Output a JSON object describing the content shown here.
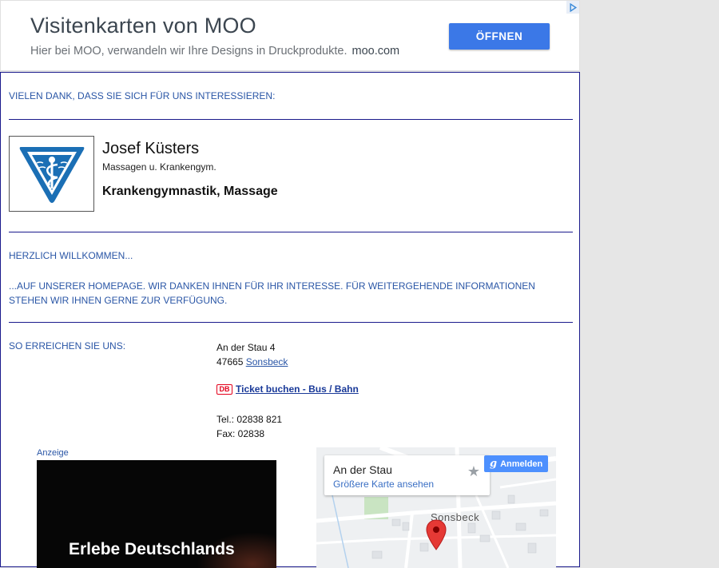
{
  "ad_top": {
    "title": "Visitenkarten von MOO",
    "description": "Hier bei MOO, verwandeln wir Ihre Designs in Druckprodukte.",
    "domain": "moo.com",
    "button_label": "ÖFFNEN",
    "button_color": "#3b78e7"
  },
  "intro": {
    "thanks": "VIELEN DANK, DASS SIE SICH FÜR UNS INTERESSIEREN:"
  },
  "business": {
    "name": "Josef Küsters",
    "subtitle": "Massagen u. Krankengym.",
    "category": "Krankengymnastik, Massage"
  },
  "welcome": {
    "heading": "HERZLICH WILLKOMMEN...",
    "text": "...AUF UNSERER HOMEPAGE. WIR DANKEN IHNEN FÜR IHR INTERESSE. FÜR WEITERGEHENDE INFORMATIONEN STEHEN WIR IHNEN GERNE ZUR VERFÜGUNG."
  },
  "contact": {
    "label": "SO ERREICHEN SIE UNS:",
    "street": "An der Stau 4",
    "zip": "47665",
    "city": "Sonsbeck",
    "db_logo": "DB",
    "ticket_link": "Ticket buchen - Bus / Bahn",
    "tel": "Tel.: 02838 821",
    "fax": "Fax: 02838"
  },
  "video_ad": {
    "label": "Anzeige",
    "text": "Erlebe Deutschlands"
  },
  "map": {
    "place_title": "An der Stau",
    "larger_map_link": "Größere Karte ansehen",
    "signin_label": "Anmelden",
    "signin_g": "g",
    "town_label": "Sonsbeck",
    "pin_color": "#e53935"
  },
  "colors": {
    "text_blue": "#2a56a6",
    "border_navy": "#1a1a8c"
  }
}
